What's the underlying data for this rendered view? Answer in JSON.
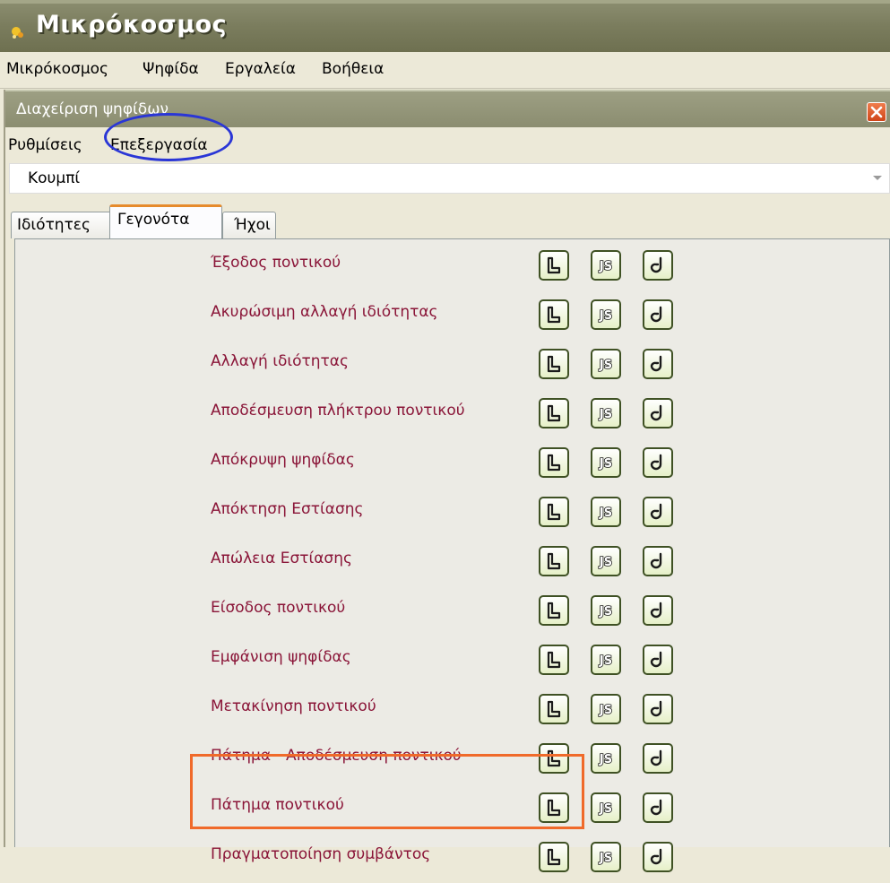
{
  "app": {
    "title": "Μικρόκοσμος"
  },
  "menubar": {
    "items": [
      "Μικρόκοσμος",
      "Ψηφίδα",
      "Εργαλεία",
      "Βοήθεια"
    ]
  },
  "dialog": {
    "title": "Διαχείριση ψηφίδων",
    "menu": [
      "Ρυθμίσεις",
      "Επεξεργασία"
    ],
    "combo_value": "Κουμπί",
    "tabs": [
      "Ιδιότητες",
      "Γεγονότα",
      "Ήχοι"
    ],
    "active_tab": "Γεγονότα"
  },
  "events": [
    "Έξοδος ποντικού",
    "Ακυρώσιμη αλλαγή ιδιότητας",
    "Αλλαγή ιδιότητας",
    "Αποδέσμευση πλήκτρου ποντικού",
    "Απόκρυψη ψηφίδας",
    "Απόκτηση Εστίασης",
    "Απώλεια Εστίασης",
    "Είσοδος ποντικού",
    "Εμφάνιση ψηφίδας",
    "Μετακίνηση ποντικού",
    "Πάτημα - Αποδέσμευση ποντικού",
    "Πάτημα ποντικού",
    "Πραγματοποίηση συμβάντος"
  ],
  "row_button_icons": [
    "logo-editor-icon",
    "javascript-editor-icon",
    "java-editor-icon"
  ],
  "colors": {
    "event_label": "#8a1538",
    "highlight_tab": "#2a36d6",
    "highlight_row": "#f06a2a"
  }
}
